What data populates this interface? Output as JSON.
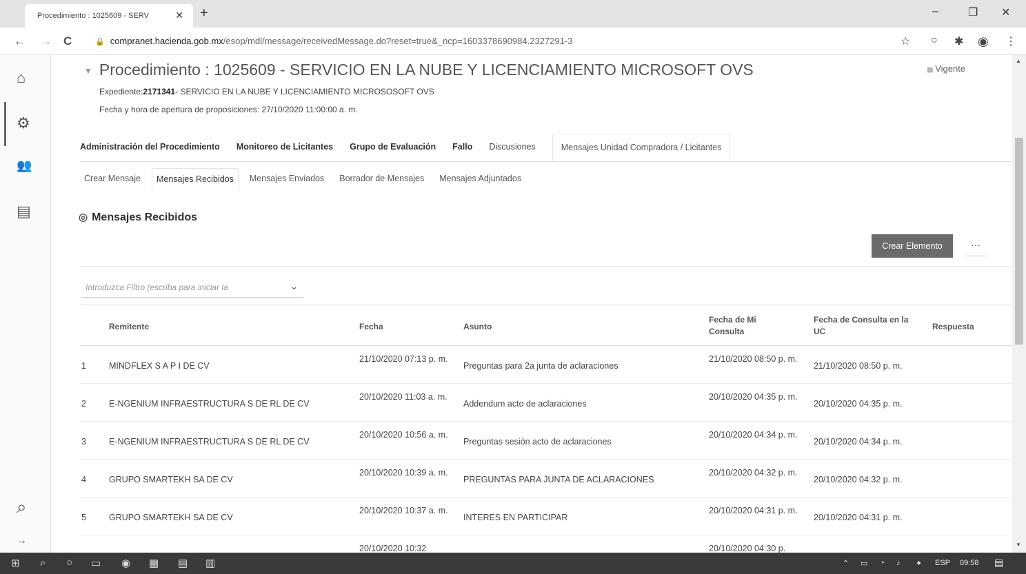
{
  "browser": {
    "tab_title": "Procedimiento : 1025609 - SERV",
    "tab_close": "✕",
    "new_tab": "+",
    "win_min": "–",
    "win_max": "❐",
    "win_close": "✕",
    "url_host": "compranet.hacienda.gob.mx",
    "url_path": "/esop/mdl/message/receivedMessage.do?reset=true&_ncp=1603378690984.2327291-3",
    "back": "←",
    "forward": "→",
    "reload": "C",
    "star": "☆",
    "ext1": "○",
    "ext2": "✱",
    "profile": "◉",
    "menu": "⋮"
  },
  "sidebar": {
    "home_icon": "⌂",
    "nav_icon": "⚙",
    "users_icon": "👥",
    "docs_icon": "▤",
    "search_icon": "⌕",
    "expand_icon": "→"
  },
  "procedure": {
    "title": "Procedimiento : 1025609 - SERVICIO EN LA NUBE Y LICENCIAMIENTO MICROSOFT OVS",
    "status": "Vigente",
    "expediente_label": "Expediente:",
    "expediente_num": "2171341",
    "expediente_rest": "- SERVICIO EN LA NUBE Y LICENCIAMIENTO MICROSOSOFT OVS",
    "opening": "Fecha y hora de apertura de proposiciones: 27/10/2020 11:00:00 a. m."
  },
  "main_tabs": [
    "Administración del Procedimiento",
    "Monitoreo de Licitantes",
    "Grupo de Evaluación",
    "Fallo",
    "Discusiones",
    "Mensajes Unidad Compradora / Licitantes"
  ],
  "sub_tabs": [
    "Crear Mensaje",
    "Mensajes Recibidos",
    "Mensajes Enviados",
    "Borrador de Mensajes",
    "Mensajes Adjuntados"
  ],
  "section_title": "Mensajes Recibidos",
  "toolbar": {
    "create_label": "Crear Elemento",
    "more_label": "···",
    "filter_placeholder": "Introduzca Filtro (escriba para iniciar la",
    "filter_chevron": "⌄"
  },
  "table": {
    "headers": {
      "remitente": "Remitente",
      "fecha": "Fecha",
      "asunto": "Asunto",
      "fecha_mi": "Fecha de Mi Consulta",
      "fecha_uc": "Fecha de Consulta en la UC",
      "respuesta": "Respuesta"
    },
    "rows": [
      {
        "num": "1",
        "remitente": "MINDFLEX S A P I DE CV",
        "fecha": "21/10/2020 07:13 p. m.",
        "asunto": "Preguntas para 2a junta de aclaraciones",
        "fecha_mi": "21/10/2020 08:50 p. m.",
        "fecha_uc": "21/10/2020 08:50 p. m."
      },
      {
        "num": "2",
        "remitente": "E-NGENIUM INFRAESTRUCTURA S DE RL DE CV",
        "fecha": "20/10/2020 11:03 a. m.",
        "asunto": "Addendum acto de aclaraciones",
        "fecha_mi": "20/10/2020 04:35 p. m.",
        "fecha_uc": "20/10/2020 04:35 p. m."
      },
      {
        "num": "3",
        "remitente": "E-NGENIUM INFRAESTRUCTURA S DE RL DE CV",
        "fecha": "20/10/2020 10:56 a. m.",
        "asunto": "Preguntas sesión acto de aclaraciones",
        "fecha_mi": "20/10/2020 04:34 p. m.",
        "fecha_uc": "20/10/2020 04:34 p. m."
      },
      {
        "num": "4",
        "remitente": "GRUPO SMARTEKH SA DE CV",
        "fecha": "20/10/2020 10:39 a. m.",
        "asunto": "PREGUNTAS PARA JUNTA DE ACLARACIONES",
        "fecha_mi": "20/10/2020 04:32 p. m.",
        "fecha_uc": "20/10/2020 04:32 p. m."
      },
      {
        "num": "5",
        "remitente": "GRUPO SMARTEKH SA DE CV",
        "fecha": "20/10/2020 10:37 a. m.",
        "asunto": "INTERES EN PARTICIPAR",
        "fecha_mi": "20/10/2020 04:31 p. m.",
        "fecha_uc": "20/10/2020 04:31 p. m."
      },
      {
        "num": "",
        "remitente": "",
        "fecha": "20/10/2020 10:32",
        "asunto": "",
        "fecha_mi": "20/10/2020 04:30 p.",
        "fecha_uc": ""
      }
    ]
  },
  "taskbar": {
    "lang": "ESP",
    "time": "09:58"
  }
}
